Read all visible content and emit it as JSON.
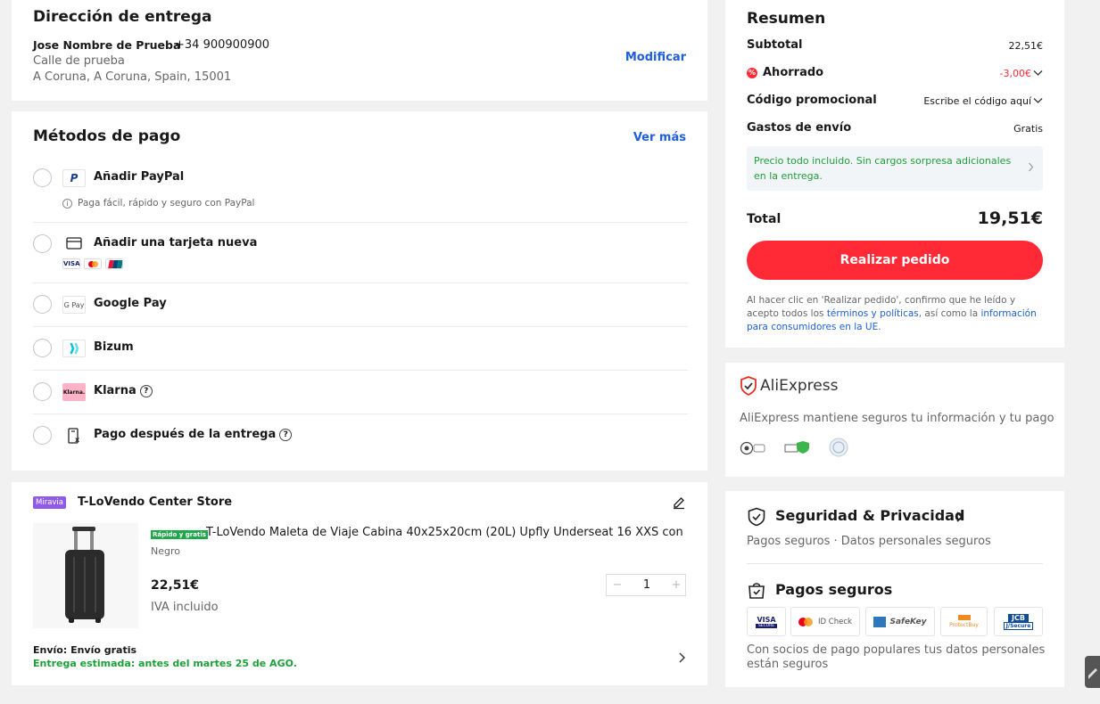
{
  "address": {
    "title": "Dirección de entrega",
    "name": "Jose Nombre de Prueba",
    "phone": "+34 900900900",
    "street": "Calle de prueba",
    "city": "A Coruna, A Coruna, Spain, 15001",
    "modify": "Modificar"
  },
  "payment": {
    "title": "Métodos de pago",
    "see_more": "Ver más",
    "methods": [
      {
        "label": "Añadir PayPal",
        "sub": "Paga fácil, rápido y seguro con PayPal",
        "icon": "paypal-icon"
      },
      {
        "label": "Añadir una tarjeta nueva",
        "icon": "card-icon",
        "brands": [
          "VISA",
          "Mastercard",
          "UnionPay"
        ]
      },
      {
        "label": "Google Pay",
        "icon": "google-pay-icon",
        "icon_text": "G Pay"
      },
      {
        "label": "Bizum",
        "icon": "bizum-icon"
      },
      {
        "label": "Klarna",
        "icon": "klarna-icon",
        "icon_text": "Klarna."
      },
      {
        "label": "Pago después de la entrega",
        "icon": "cash-on-delivery-icon"
      }
    ],
    "visa_text": "VISA"
  },
  "store": {
    "badge": "Miravia",
    "name": "T-LoVendo Center Store",
    "product": {
      "tag": "Rápido y gratis",
      "title": "T-LoVendo Maleta de Viaje Cabina 40x25x20cm (20L) Upfly Underseat 16 XXS con ...",
      "color": "Negro",
      "price": "22,51€",
      "tax": "IVA incluido",
      "qty": "1",
      "minus": "−",
      "plus": "+"
    },
    "shipping": "Envío: Envío gratis",
    "estimate": "Entrega estimada: antes del martes 25 de AGO."
  },
  "summary": {
    "title": "Resumen",
    "subtotal_label": "Subtotal",
    "subtotal": "22,51€",
    "saved_label": "Ahorrado",
    "saved": "-3,00€",
    "promo_label": "Código promocional",
    "promo_value": "Escribe el código aquí",
    "shipping_label": "Gastos de envío",
    "shipping_value": "Gratis",
    "notice": "Precio todo incluido. Sin cargos sorpresa adicionales en la entrega.",
    "total_label": "Total",
    "total": "19,51€",
    "place_order": "Realizar pedido",
    "legal_1": "Al hacer clic en 'Realizar pedido', confirmo que he leído y acepto todos los ",
    "legal_link1": "términos y políticas",
    "legal_2": ", así como la ",
    "legal_link2": "información para consumidores en la UE",
    "legal_3": "."
  },
  "aliexpress": {
    "logo": "AliExpress",
    "text": "AliExpress mantiene seguros tu información y tu pago"
  },
  "security": {
    "title": "Seguridad & Privacidad",
    "sub": "Pagos seguros · Datos personales seguros",
    "pay_title": "Pagos seguros",
    "logos": [
      "VISA",
      "ID Check",
      "SafeKey",
      "ProtectBuy",
      "JCB"
    ],
    "visa_secure_sub": "SECURE",
    "jcb_sub": "J/Secure",
    "footer": "Con socios de pago populares tus datos personales están seguros"
  },
  "colors": {
    "accent": "#ff2a35",
    "link": "#1f5fd9",
    "green": "#1f9e3a"
  }
}
